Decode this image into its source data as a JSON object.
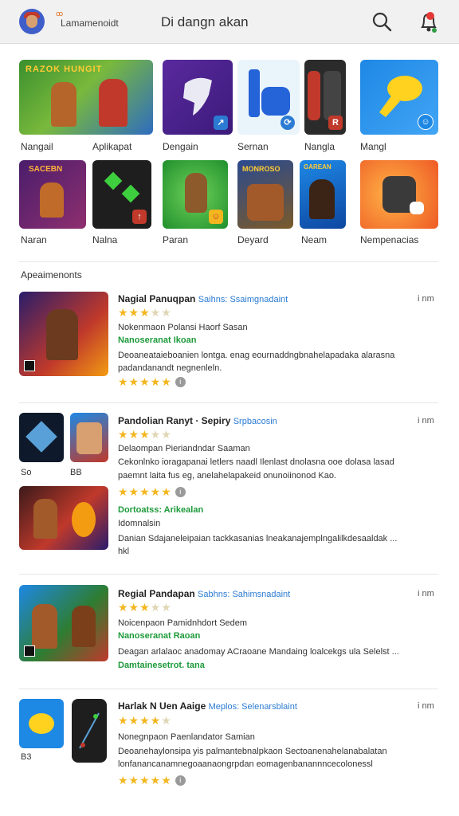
{
  "header": {
    "account_badge": "ꝏ",
    "account_name": "Lamamenoidt",
    "title": "Di dangn akan",
    "search_icon": "search-icon",
    "bell_icon": "bell-icon",
    "accent": "#e53935"
  },
  "grid": {
    "row1": [
      {
        "label": "Nangail",
        "title_art": "RAZOK HUNGIT"
      },
      {
        "label": "Aplikapat"
      },
      {
        "label": "Dengain"
      },
      {
        "label": "Sernan"
      },
      {
        "label": "Nangla"
      },
      {
        "label": "Mangl"
      }
    ],
    "row2": [
      {
        "label": "Naran",
        "title_art": "SACEBN"
      },
      {
        "label": "Nalna"
      },
      {
        "label": "Paran"
      },
      {
        "label": "Deyard",
        "title_art": "MONROSO"
      },
      {
        "label": "Neam",
        "title_art": "GAREAN"
      },
      {
        "label": "Nempenacias"
      }
    ]
  },
  "section": {
    "title": "Apeaimenonts"
  },
  "cards": [
    {
      "title": "Nagial Panuqpan",
      "publisher": "Saihns: Ssaimgnadaint",
      "time": "i nm",
      "line1": "Nokenmaon Polansi Haorf Sasan",
      "line2": "Nanoseranat Ikoan",
      "line3": "Deoaneataieboanien lontga. enag eournaddngbnahelapadaka alarasna",
      "line4": "padandanandt negnenleln.",
      "rating_top": "3 of 5",
      "rating_bottom": "5 of 5"
    },
    {
      "title": "Pandolian Ranyt · Sepiry",
      "publisher": "Srpbacosin",
      "time": "i nm",
      "thumb_labels": [
        "So",
        "BB"
      ],
      "line1": "Delaompan Pieriandndar Saaman",
      "line2": "Cekonlnko ioragapanai letlers naadl Ilenlast dnolasna ooe dolasa lasad",
      "line3": "paemnt laita fus eg, anelahelapakeid onunoiinonod Kao.",
      "line4": "Dortoatss: Arikealan",
      "line5": "Idomnalsin",
      "line6": "Danian Sdajaneleipaian tackkasanias lneakanajemplngalilkdesaaldak ...",
      "line7": "hkl",
      "rating_top": "3 of 5",
      "rating_bottom": "5 of 5"
    },
    {
      "title": "Regial Pandapan",
      "publisher": "Sabhns: Sahimsnadaint",
      "time": "i nm",
      "line1": "Noicenpaon Pamidnhdort Sedem",
      "line2": "Nanoseranat Raoan",
      "line3": "Deagan arlalaoc anadomay ACraoane Mandaing loalcekgs ula Selelst ...",
      "line4": "Damtainesetrot. tana",
      "rating_top": "3 of 5"
    },
    {
      "title": "Harlak N Uen Aaige",
      "publisher": "Meplos: Selenarsblaint",
      "time": "i nm",
      "thumb_label": "B3",
      "line1": "Nonegnpaon Paenlandator Samian",
      "line2": "Deoanehaylonsipa yis palmantebnalpkaon Sectoanenahelanabalatan",
      "line3": "lonfanancanamnegoaanaongrpdan eomagenbanannncecolonessl",
      "rating_top": "4 of 5",
      "rating_bottom": "5 of 5"
    }
  ]
}
